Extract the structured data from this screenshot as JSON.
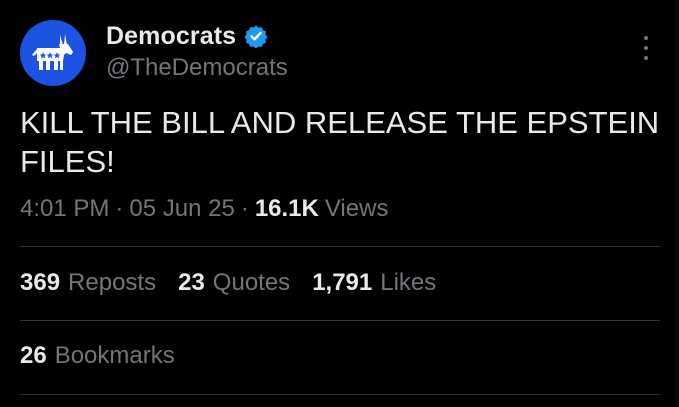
{
  "tweet": {
    "author": {
      "display_name": "Democrats",
      "handle": "@TheDemocrats",
      "verified": true,
      "avatar_icon": "donkey-icon",
      "avatar_color": "#1a54e0",
      "verified_color": "#1d9bf0"
    },
    "text_lines": [
      "KILL THE BILL AND RELEASE THE EPSTEIN",
      "FILES!"
    ],
    "meta": {
      "time": "4:01 PM",
      "date": "05 Jun 25",
      "separator": "·",
      "views_count": "16.1K",
      "views_label": "Views"
    },
    "stats": {
      "reposts": {
        "count": "369",
        "label": "Reposts"
      },
      "quotes": {
        "count": "23",
        "label": "Quotes"
      },
      "likes": {
        "count": "1,791",
        "label": "Likes"
      },
      "bookmarks": {
        "count": "26",
        "label": "Bookmarks"
      }
    },
    "more_icon": "more-vertical-icon"
  }
}
